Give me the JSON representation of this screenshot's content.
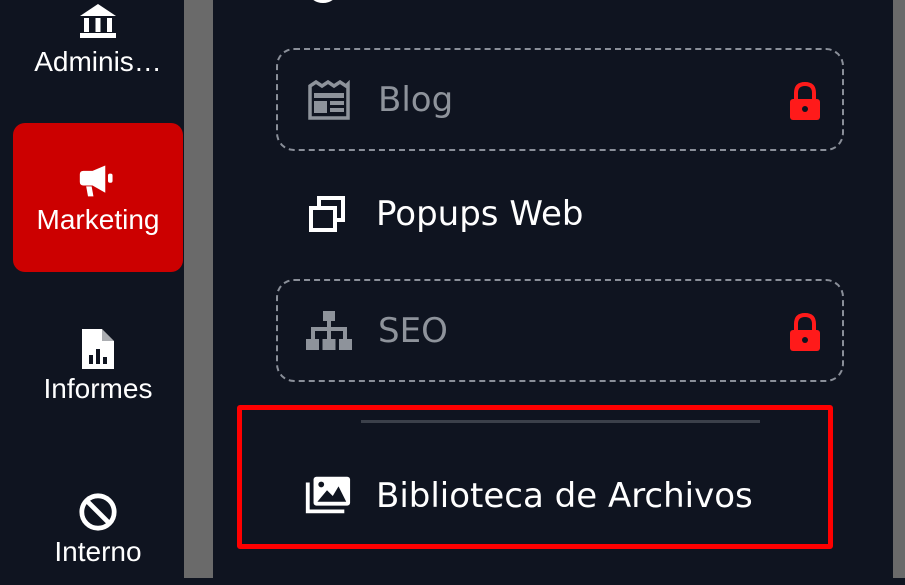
{
  "sidebar": {
    "items": [
      {
        "label": "Adminis…",
        "icon": "bank-icon"
      },
      {
        "label": "Marketing",
        "icon": "megaphone-icon",
        "active": true
      },
      {
        "label": "Informes",
        "icon": "report-file-icon"
      },
      {
        "label": "Interno",
        "icon": "ban-icon"
      }
    ]
  },
  "submenu": {
    "items": [
      {
        "label": "Blog",
        "icon": "newspaper-icon",
        "locked": true
      },
      {
        "label": "Popups Web",
        "icon": "window-restore-icon",
        "locked": false
      },
      {
        "label": "SEO",
        "icon": "sitemap-icon",
        "locked": true
      },
      {
        "label": "Biblioteca de Archivos",
        "icon": "photo-library-icon",
        "locked": false,
        "highlighted": true
      }
    ]
  },
  "colors": {
    "background": "#0f1420",
    "active": "#cc0000",
    "lock": "#ff1a1a",
    "highlight_border": "#ff0000",
    "muted_text": "#8e939b"
  }
}
